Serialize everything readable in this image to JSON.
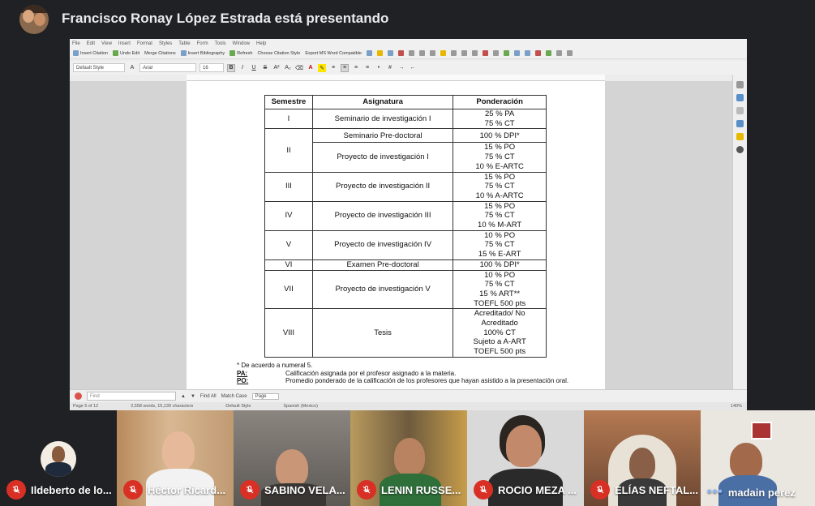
{
  "meeting": {
    "presenter_banner": "Francisco Ronay López Estrada está presentando"
  },
  "editor": {
    "menu": [
      "File",
      "Edit",
      "View",
      "Insert",
      "Format",
      "Styles",
      "Table",
      "Form",
      "Tools",
      "Window",
      "Help"
    ],
    "toolbar_zotero": [
      "Insert Citation",
      "Undo Edit",
      "Merge Citations",
      "Insert Bibliography",
      "Refresh",
      "Choose Citation Style",
      "Export MS Word Compatible"
    ],
    "paragraph_style": "Default Style",
    "font_name": "Arial",
    "font_size": "16",
    "find_placeholder": "Find",
    "find_all": "Find All",
    "match_case": "Match Case",
    "search_scope": "Page",
    "status": {
      "page": "Page 5 of 12",
      "words": "2,558 words, 15,139 characters",
      "style": "Default Style",
      "language": "Spanish (Mexico)",
      "zoom": "140%"
    }
  },
  "table": {
    "headers": [
      "Semestre",
      "Asignatura",
      "Ponderación"
    ],
    "rows": [
      {
        "semestre": "I",
        "asignatura": "Seminario de investigación I",
        "ponderacion": "25 % PA\n75  % CT"
      },
      {
        "semestre": "II",
        "asignatura": "Seminario Pre-doctoral",
        "ponderacion": "100 % DPI*"
      },
      {
        "semestre": "",
        "asignatura": "Proyecto de investigación I",
        "ponderacion": "15 % PO\n75 % CT\n10 % E-ARTC"
      },
      {
        "semestre": "III",
        "asignatura": "Proyecto de investigación II",
        "ponderacion": "15  % PO\n75 % CT\n10 % A-ARTC"
      },
      {
        "semestre": "IV",
        "asignatura": "Proyecto de investigación III",
        "ponderacion": "15 % PO\n75 % CT\n10 % M-ART"
      },
      {
        "semestre": "V",
        "asignatura": "Proyecto de investigación IV",
        "ponderacion": "10 % PO\n75 % CT\n15 % E-ART"
      },
      {
        "semestre": "VI",
        "asignatura": "Examen Pre-doctoral",
        "ponderacion": "100 % DPI*"
      },
      {
        "semestre": "VII",
        "asignatura": "Proyecto de investigación V",
        "ponderacion": "10 % PO\n75 % CT\n15 % ART**\nTOEFL 500 pts"
      },
      {
        "semestre": "VIII",
        "asignatura": "Tesis",
        "ponderacion": "Acreditado/ No\nAcreditado\n100% CT\nSujeto a A-ART\nTOEFL 500 pts"
      }
    ]
  },
  "footnotes": {
    "intro": "* De acuerdo a numeral 5.",
    "items": [
      {
        "key": "PA:",
        "text": "Calificación asignada por el profesor asignado a la materia."
      },
      {
        "key": "PO:",
        "text": "Promedio ponderado de la calificación de los profesores que hayan asistido a la presentación oral."
      }
    ]
  },
  "participants": [
    {
      "name": "Ildeberto de lo...",
      "muted": true
    },
    {
      "name": "Héctor Ricard...",
      "muted": true
    },
    {
      "name": "SABINO VELA...",
      "muted": true
    },
    {
      "name": "LENIN RUSSE...",
      "muted": true
    },
    {
      "name": "ROCIO MEZA ...",
      "muted": true
    },
    {
      "name": "ELÍAS NEFTAL...",
      "muted": true
    },
    {
      "name": "madain perez",
      "muted": false
    }
  ],
  "colors": {
    "meet_background": "#202124",
    "mic_off": "#d93025",
    "accent": "#8ab4f8"
  }
}
